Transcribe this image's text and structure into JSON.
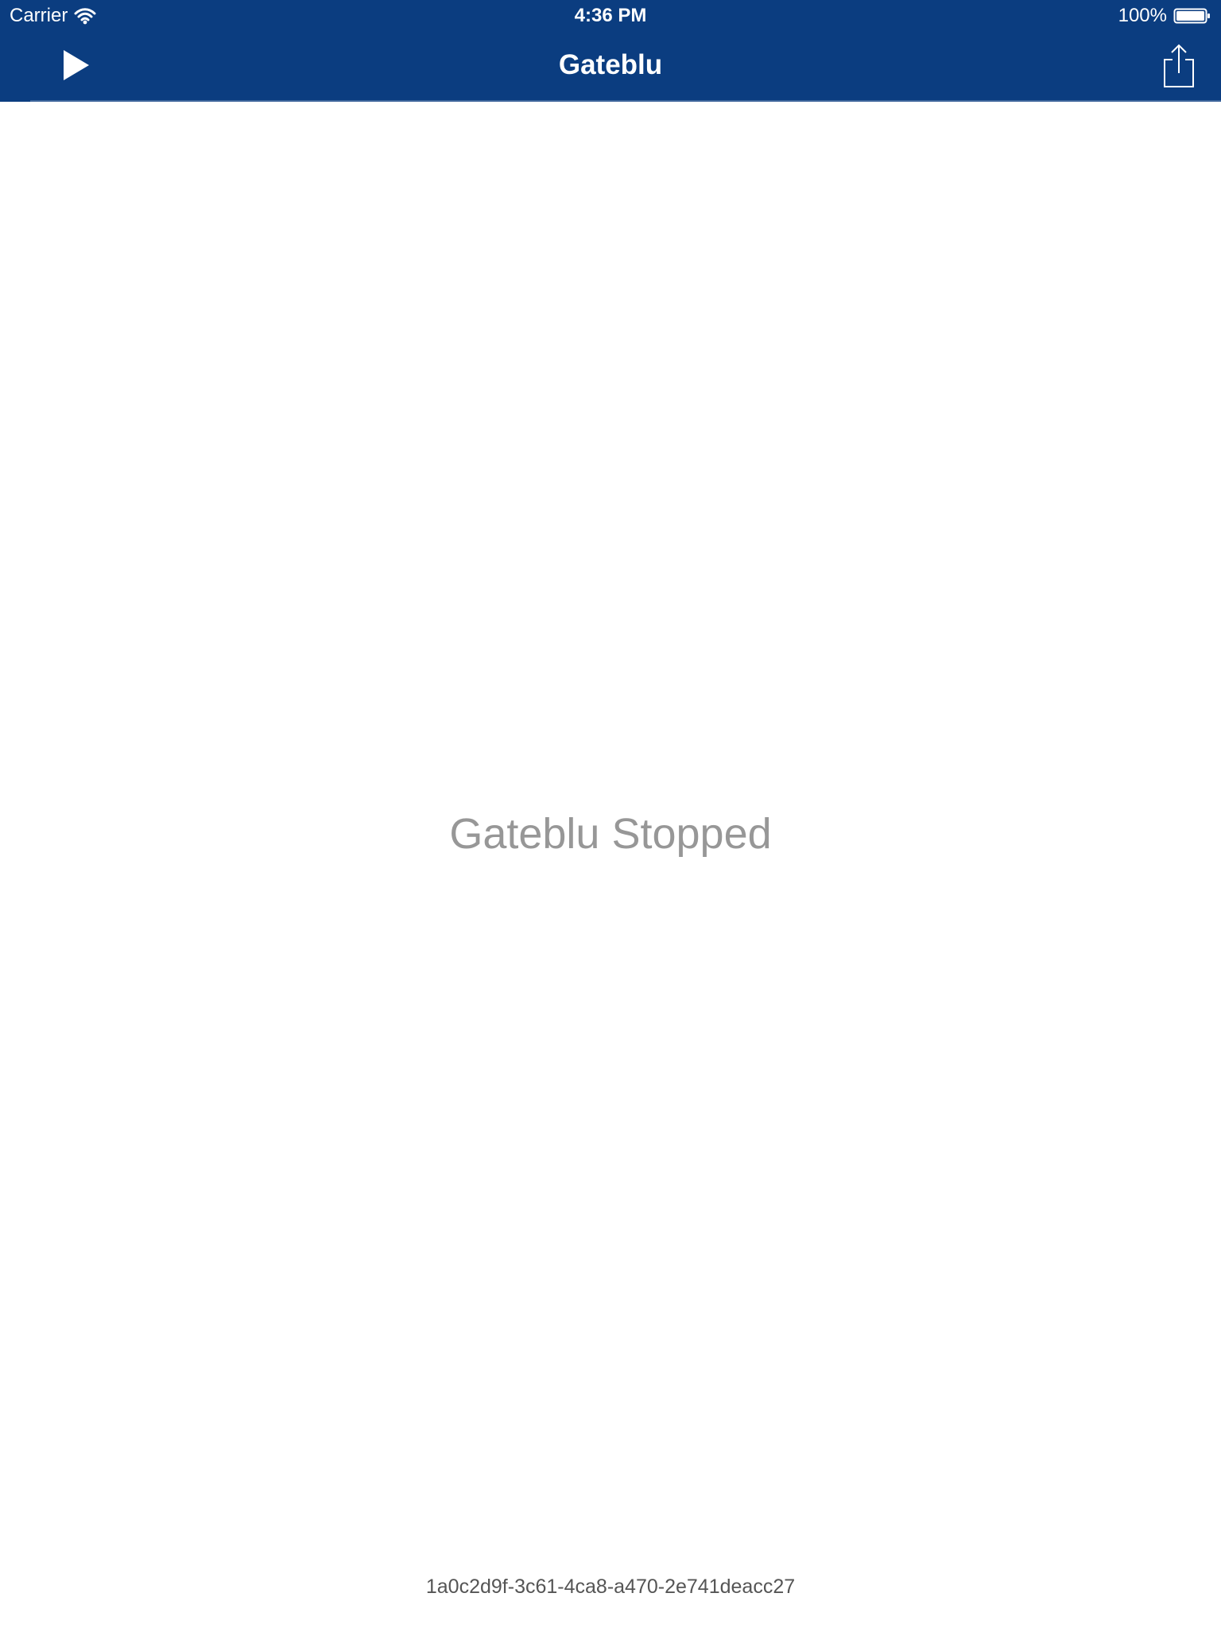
{
  "status_bar": {
    "carrier": "Carrier",
    "time": "4:36 PM",
    "battery_percent": "100%",
    "wifi_icon": "wifi-icon",
    "battery_icon": "battery-icon"
  },
  "navigation": {
    "title": "Gateblu",
    "play_icon": "play-icon",
    "share_icon": "share-icon"
  },
  "main": {
    "status_message": "Gateblu Stopped",
    "device_id": "1a0c2d9f-3c61-4ca8-a470-2e741deacc27"
  },
  "colors": {
    "navigation_background": "#0B3D80",
    "status_message": "#979797",
    "device_id": "#555555",
    "background": "#FFFFFF"
  }
}
